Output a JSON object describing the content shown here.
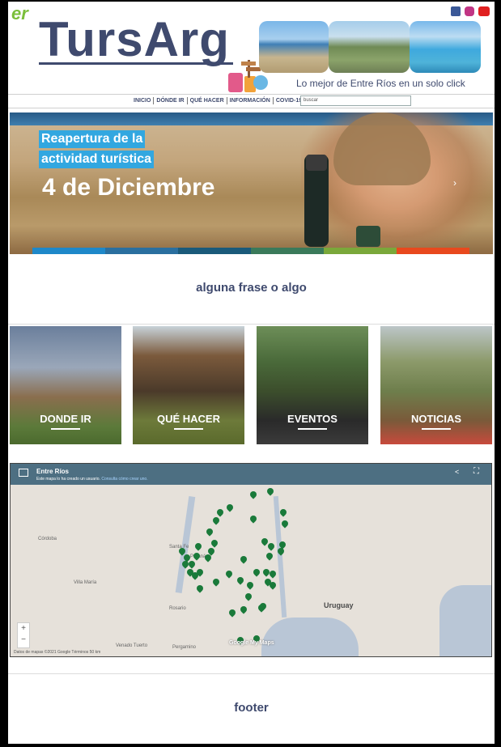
{
  "header": {
    "logo_text": "er",
    "brand": "TursArg",
    "tagline": "Lo mejor de Entre Ríos en un solo click",
    "social_icons": [
      "facebook-icon",
      "instagram-icon",
      "youtube-icon"
    ],
    "brand_color": "#3f4a6e"
  },
  "nav": {
    "items": [
      "INICIO",
      "DÓNDE IR",
      "QUÉ HACER",
      "INFORMACIÓN",
      "COVID-19"
    ],
    "search_placeholder": "buscar"
  },
  "hero": {
    "line1": "Reapertura de la",
    "line2": "actividad turística",
    "line3": "4 de Diciembre",
    "next_arrow": "›",
    "stripe_colors": [
      "#1e88c9",
      "#2a6f9f",
      "#1a5a7a",
      "#3a7a5a",
      "#7aa83a",
      "#e8491e"
    ]
  },
  "phrase": "alguna frase o algo",
  "cards": [
    {
      "label": "DONDE IR"
    },
    {
      "label": "QUÉ HACER"
    },
    {
      "label": "EVENTOS"
    },
    {
      "label": "NOTICIAS"
    }
  ],
  "map": {
    "title": "Entre Ríos",
    "notice": "Este mapa lo ha creado un usuario.",
    "notice_link": "Consulta cómo crear uno.",
    "country_label": "Uruguay",
    "city_labels": [
      "Córdoba",
      "Santa Fe",
      "Rosario",
      "Villa María",
      "Paraná",
      "Pergamino",
      "Venado Tuerto"
    ],
    "zoom_in": "+",
    "zoom_out": "−",
    "footer_text": "Datos de mapas ©2021 Google   Términos   50 km",
    "brand": "Google My Maps",
    "pin_color": "#1a7a3a"
  },
  "footer": "footer"
}
